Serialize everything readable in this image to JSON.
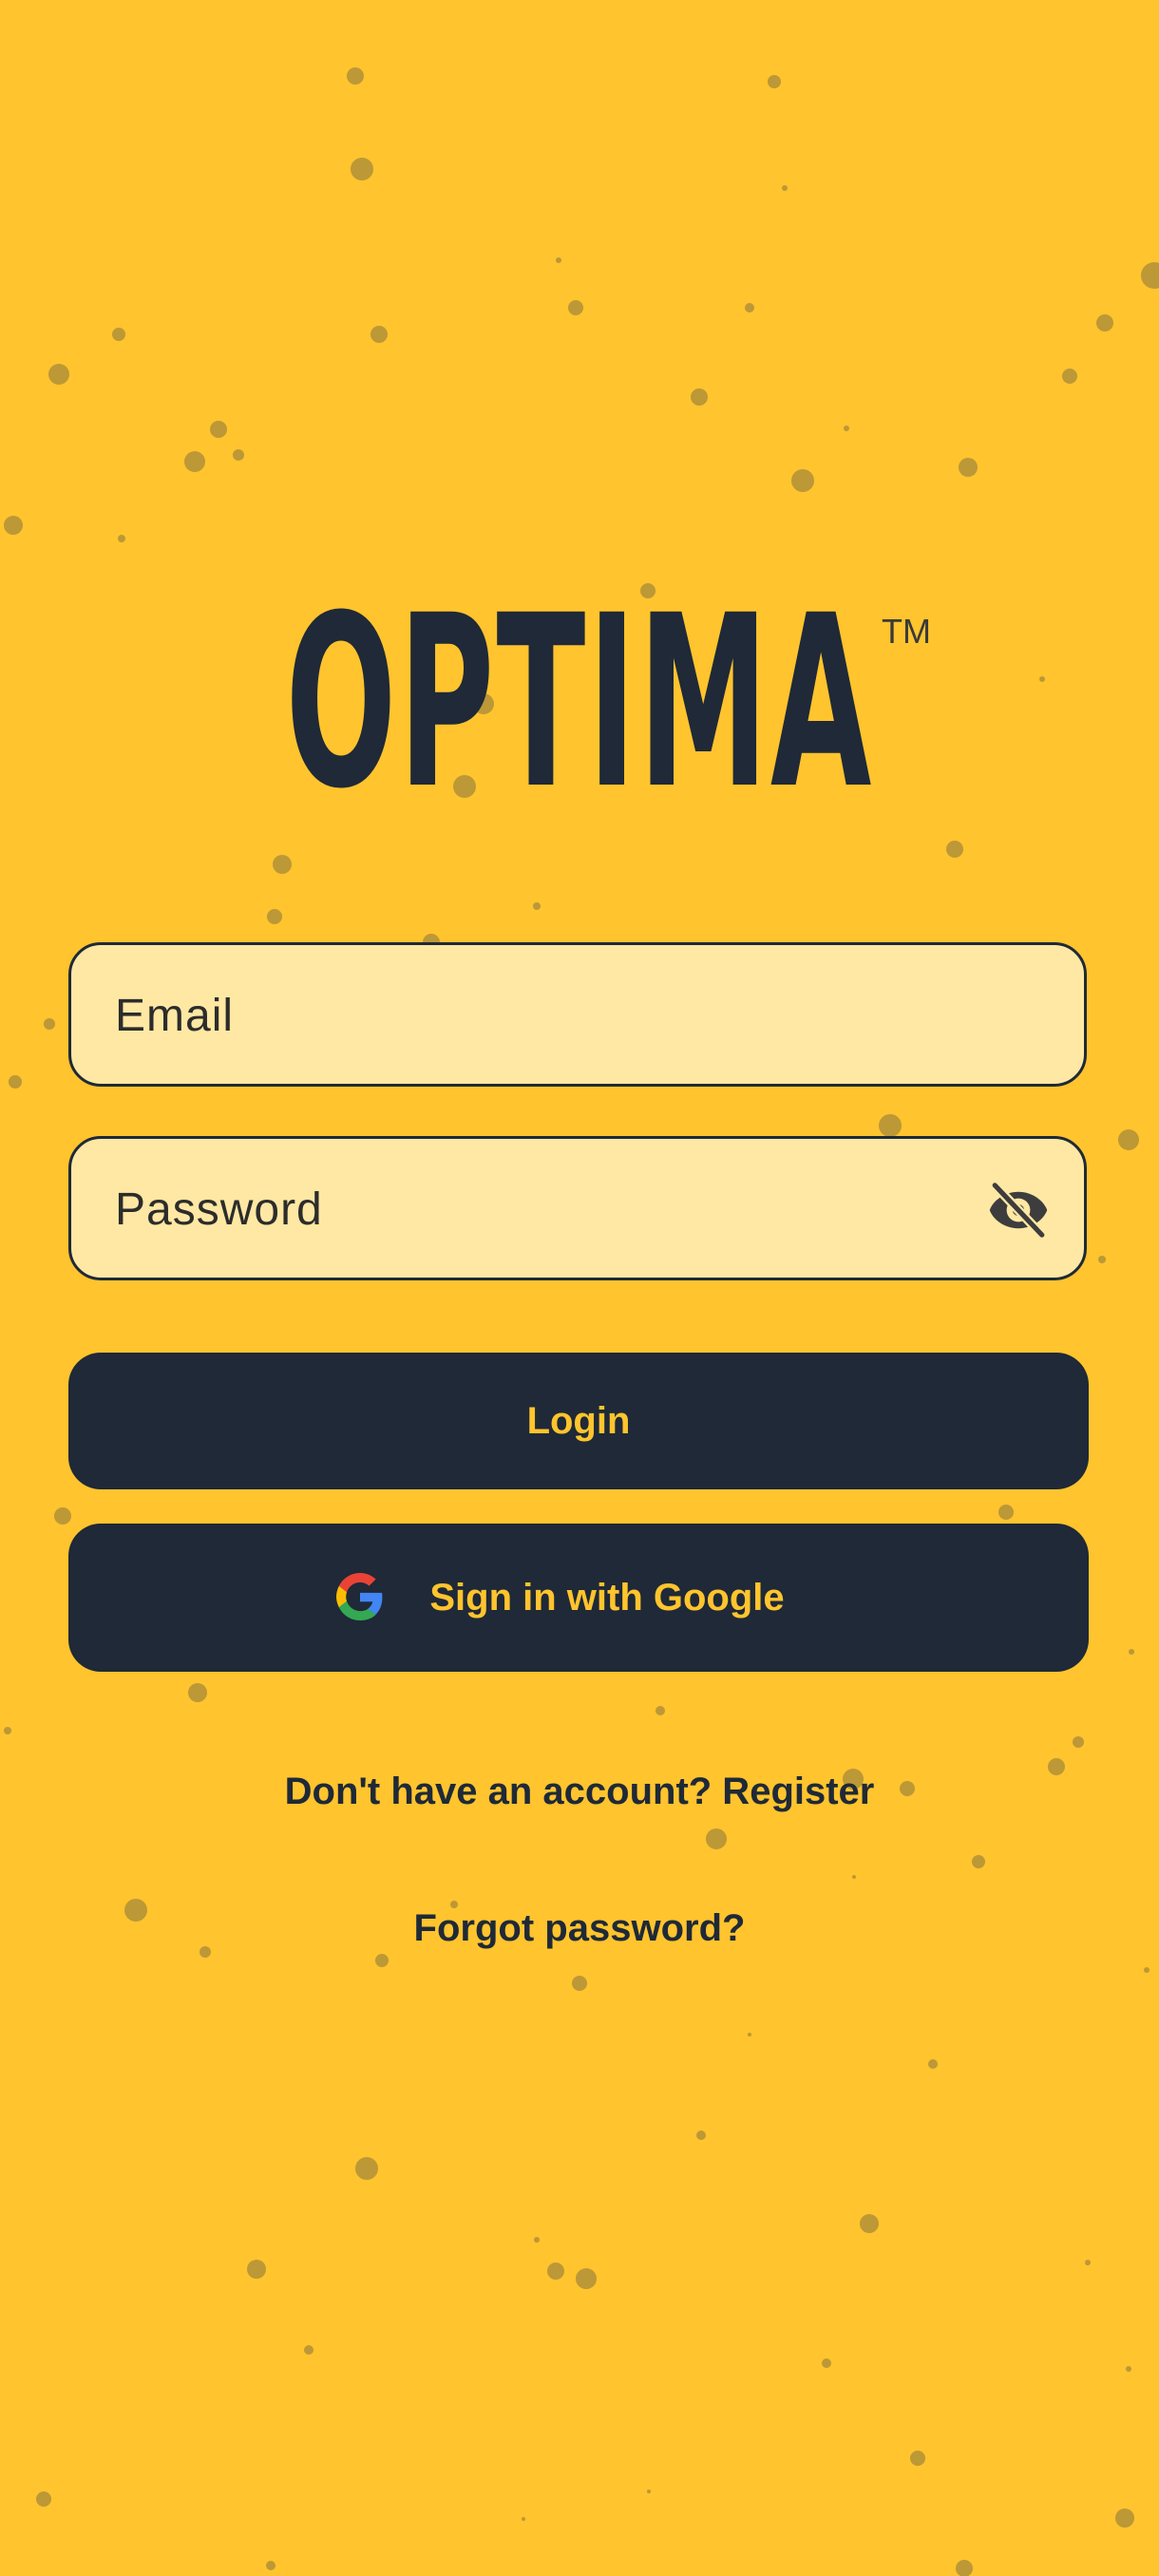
{
  "logo": {
    "text": "OPTIMA",
    "trademark": "TM"
  },
  "email": {
    "placeholder": "Email",
    "value": ""
  },
  "password": {
    "placeholder": "Password",
    "value": "",
    "toggle_icon": "eye-off-icon"
  },
  "login_button": {
    "label": "Login"
  },
  "google_button": {
    "label": "Sign in with Google",
    "icon": "google-icon"
  },
  "register_link": {
    "label": "Don't have an account? Register"
  },
  "forgot_link": {
    "label": "Forgot password?"
  },
  "colors": {
    "background": "#FFC42E",
    "input_fill": "#FFE8A3",
    "dark": "#1F2937",
    "accent_text": "#FFC42E"
  }
}
